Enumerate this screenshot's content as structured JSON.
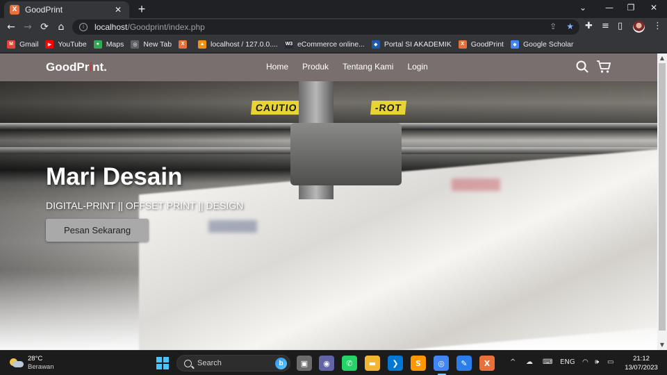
{
  "browser": {
    "tab_title": "GoodPrint",
    "tab_favicon_letter": "X",
    "tab_close": "✕",
    "new_tab": "+",
    "window_controls": [
      "⌄",
      "—",
      "❐",
      "✕"
    ],
    "url_host": "localhost",
    "url_path": "/Goodprint/index.php",
    "nav": {
      "back": "←",
      "forward": "→",
      "reload": "⟳",
      "home": "⌂"
    },
    "toolbar_icons": [
      "✚",
      "≡",
      "▯",
      "⋮"
    ]
  },
  "bookmarks": [
    {
      "label": "Gmail",
      "icon": "gmail-icon",
      "color": "#ea4335",
      "glyph": "M"
    },
    {
      "label": "YouTube",
      "icon": "youtube-icon",
      "color": "#ff0000",
      "glyph": "▶"
    },
    {
      "label": "Maps",
      "icon": "maps-icon",
      "color": "#34a853",
      "glyph": "●"
    },
    {
      "label": "New Tab",
      "icon": "globe-icon",
      "color": "#5f6368",
      "glyph": "◎"
    },
    {
      "label": "",
      "icon": "xampp-icon",
      "color": "#e8703a",
      "glyph": "X"
    },
    {
      "label": "localhost / 127.0.0....",
      "icon": "phpmyadmin-icon",
      "color": "#f29111",
      "glyph": "▲"
    },
    {
      "label": "eCommerce online...",
      "icon": "w3schools-icon",
      "color": "#282a35",
      "glyph": "W3"
    },
    {
      "label": "Portal SI AKADEMIK",
      "icon": "portal-icon",
      "color": "#1e5aa8",
      "glyph": "◆"
    },
    {
      "label": "GoodPrint",
      "icon": "xampp-icon",
      "color": "#e8703a",
      "glyph": "X"
    },
    {
      "label": "Google Scholar",
      "icon": "scholar-icon",
      "color": "#4285f4",
      "glyph": "◆"
    }
  ],
  "site": {
    "logo_main": "GoodPr",
    "logo_accent": "i",
    "logo_end": "nt.",
    "menu": [
      "Home",
      "Produk",
      "Tentang Kami",
      "Login"
    ],
    "hero_title": "Mari Desain",
    "hero_subtitle": "DIGITAL-PRINT || OFFSET PRINT || DESIGN",
    "hero_button": "Pesan Sekarang",
    "caution_1": "CAUTIO",
    "caution_2": "-ROT"
  },
  "taskbar": {
    "temperature": "28°C",
    "weather": "Berawan",
    "search_label": "Search",
    "bing_glyph": "b",
    "apps": [
      {
        "name": "task-view-icon",
        "color": "#6b6b6b",
        "glyph": "▣"
      },
      {
        "name": "teams-icon",
        "color": "#6264a7",
        "glyph": "◉"
      },
      {
        "name": "whatsapp-icon",
        "color": "#25d366",
        "glyph": "✆"
      },
      {
        "name": "file-explorer-icon",
        "color": "#f2b632",
        "glyph": "▬"
      },
      {
        "name": "vscode-icon",
        "color": "#0078d4",
        "glyph": "❯"
      },
      {
        "name": "sublime-icon",
        "color": "#ff9800",
        "glyph": "S"
      },
      {
        "name": "chrome-icon",
        "color": "#4285f4",
        "glyph": "◎"
      },
      {
        "name": "paint-icon",
        "color": "#2b7de9",
        "glyph": "✎"
      },
      {
        "name": "xampp-icon",
        "color": "#e8703a",
        "glyph": "X"
      }
    ],
    "tray_glyphs": [
      "^",
      "☁",
      "⌨"
    ],
    "language": "ENG",
    "tray_status": [
      "◠",
      "🕪",
      "▭"
    ],
    "time": "21:12",
    "date": "13/07/2023"
  }
}
